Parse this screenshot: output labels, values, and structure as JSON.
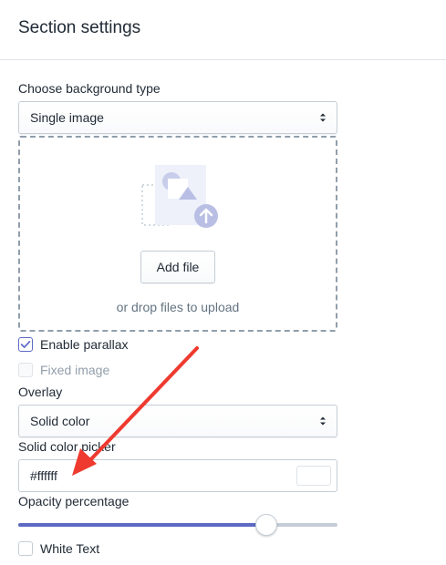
{
  "header": {
    "title": "Section settings"
  },
  "background": {
    "label": "Choose background type",
    "selected": "Single image"
  },
  "upload": {
    "button_label": "Add file",
    "hint": "or drop files to upload"
  },
  "parallax": {
    "label": "Enable parallax",
    "checked": true
  },
  "fixed_image": {
    "label": "Fixed image",
    "checked": false,
    "disabled": true
  },
  "overlay": {
    "label": "Overlay",
    "selected": "Solid color"
  },
  "color_picker": {
    "label": "Solid color picker",
    "value": "#ffffff",
    "swatch_color": "#ffffff"
  },
  "opacity": {
    "label": "Opacity percentage",
    "value_fraction": 0.777
  },
  "white_text": {
    "label": "White Text",
    "checked": false
  },
  "colors": {
    "accent": "#5c6ac4",
    "annotation_arrow": "#ee3a2f"
  }
}
